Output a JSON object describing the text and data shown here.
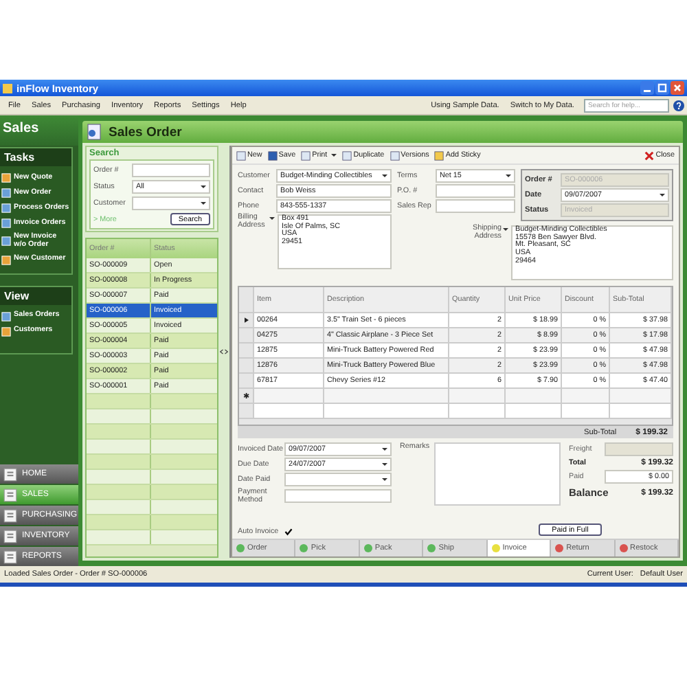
{
  "window": {
    "title": "inFlow Inventory"
  },
  "menu": [
    "File",
    "Sales",
    "Purchasing",
    "Inventory",
    "Reports",
    "Settings",
    "Help"
  ],
  "menu_right": {
    "notice": "Using Sample Data.",
    "switch_link": "Switch to My Data.",
    "help_search": {
      "placeholder": "Search for help..."
    }
  },
  "sidebar": {
    "title": "Sales",
    "tasks": {
      "title": "Tasks",
      "items": [
        "New Quote",
        "New Order",
        "Process Orders",
        "Invoice Orders",
        "New Invoice w/o Order",
        "New Customer"
      ]
    },
    "view": {
      "title": "View",
      "items": [
        "Sales Orders",
        "Customers"
      ]
    },
    "nav": [
      {
        "label": "HOME",
        "selected": false
      },
      {
        "label": "SALES",
        "selected": true
      },
      {
        "label": "PURCHASING",
        "selected": false
      },
      {
        "label": "INVENTORY",
        "selected": false
      },
      {
        "label": "REPORTS",
        "selected": false
      }
    ]
  },
  "page_title": "Sales Order",
  "search": {
    "title": "Search",
    "fields": [
      {
        "label": "Order #",
        "kind": "text"
      },
      {
        "label": "Status",
        "kind": "dropdown",
        "value": "All"
      },
      {
        "label": "Customer",
        "kind": "dropdown"
      }
    ],
    "more": "> More",
    "button": "Search"
  },
  "orders": {
    "columns": [
      "Order #",
      "Status"
    ],
    "rows": [
      {
        "order": "SO-000009",
        "status": "Open",
        "selected": false
      },
      {
        "order": "SO-000008",
        "status": "In Progress",
        "selected": false
      },
      {
        "order": "SO-000007",
        "status": "Paid",
        "selected": false
      },
      {
        "order": "SO-000006",
        "status": "Invoiced",
        "selected": true
      },
      {
        "order": "SO-000005",
        "status": "Invoiced",
        "selected": false
      },
      {
        "order": "SO-000004",
        "status": "Paid",
        "selected": false
      },
      {
        "order": "SO-000003",
        "status": "Paid",
        "selected": false
      },
      {
        "order": "SO-000002",
        "status": "Paid",
        "selected": false
      },
      {
        "order": "SO-000001",
        "status": "Paid",
        "selected": false
      }
    ]
  },
  "toolbar": [
    "New",
    "Save",
    "Print",
    "Duplicate",
    "Versions",
    "Add Sticky"
  ],
  "close": "Close",
  "customer": {
    "customer": {
      "label": "Customer",
      "value": "Budget-Minding Collectibles"
    },
    "contact": {
      "label": "Contact",
      "value": "Bob Weiss"
    },
    "phone": {
      "label": "Phone",
      "value": "843-555-1337"
    },
    "billing": {
      "label": "Billing Address",
      "value": "Box 491\nIsle Of Palms,  SC\nUSA\n29451"
    }
  },
  "terms": {
    "terms": {
      "label": "Terms",
      "value": "Net 15"
    },
    "po": {
      "label": "P.O. #"
    },
    "rep": {
      "label": "Sales Rep"
    }
  },
  "order_info": {
    "order": {
      "label": "Order #",
      "value": "SO-000006"
    },
    "date": {
      "label": "Date",
      "value": "09/07/2007"
    },
    "status": {
      "label": "Status",
      "value": "Invoiced"
    }
  },
  "shipping": {
    "label": "Shipping Address",
    "value": "Budget-Minding Collectibles\n15578 Ben Sawyer Blvd.\nMt. Pleasant,  SC\nUSA\n29464"
  },
  "items": {
    "columns": [
      "Item",
      "Description",
      "Quantity",
      "Unit Price",
      "Discount",
      "Sub-Total"
    ],
    "rows": [
      {
        "item": "00264",
        "description": "3.5\" Train Set - 6 pieces",
        "quantity": "2",
        "unit_price": "$ 18.99",
        "discount": "0 %",
        "subtotal": "$ 37.98",
        "current": true
      },
      {
        "item": "04275",
        "description": "4\" Classic Airplane - 3 Piece Set",
        "quantity": "2",
        "unit_price": "$ 8.99",
        "discount": "0 %",
        "subtotal": "$ 17.98",
        "current": false
      },
      {
        "item": "12875",
        "description": "Mini-Truck Battery Powered Red",
        "quantity": "2",
        "unit_price": "$ 23.99",
        "discount": "0 %",
        "subtotal": "$ 47.98",
        "current": false
      },
      {
        "item": "12876",
        "description": "Mini-Truck Battery Powered Blue",
        "quantity": "2",
        "unit_price": "$ 23.99",
        "discount": "0 %",
        "subtotal": "$ 47.98",
        "current": false
      },
      {
        "item": "67817",
        "description": "Chevy Series #12",
        "quantity": "6",
        "unit_price": "$ 7.90",
        "discount": "0 %",
        "subtotal": "$ 47.40",
        "current": false
      }
    ],
    "new_row_mark": "✱",
    "subtotal_label": "Sub-Total",
    "subtotal": "$ 199.32"
  },
  "payment": {
    "fields": [
      {
        "label": "Invoiced Date",
        "value": "09/07/2007",
        "kind": "dropdown"
      },
      {
        "label": "Due Date",
        "value": "24/07/2007",
        "kind": "dropdown"
      },
      {
        "label": "Date Paid",
        "kind": "dropdown"
      },
      {
        "label": "Payment Method",
        "kind": "text"
      }
    ],
    "auto_invoice": {
      "label": "Auto Invoice",
      "checked": true
    },
    "remarks_label": "Remarks"
  },
  "totals": {
    "freight_label": "Freight",
    "total_label": "Total",
    "total": "$ 199.32",
    "paid_label": "Paid",
    "paid": "$ 0.00",
    "balance_label": "Balance",
    "balance": "$ 199.32",
    "paid_in_full": "Paid in Full"
  },
  "stages": [
    {
      "label": "Order",
      "color": "#5cb85c",
      "selected": false
    },
    {
      "label": "Pick",
      "color": "#5cb85c",
      "selected": false
    },
    {
      "label": "Pack",
      "color": "#5cb85c",
      "selected": false
    },
    {
      "label": "Ship",
      "color": "#5cb85c",
      "selected": false
    },
    {
      "label": "Invoice",
      "color": "#e8e040",
      "selected": true
    },
    {
      "label": "Return",
      "color": "#d9534f",
      "selected": false
    },
    {
      "label": "Restock",
      "color": "#d9534f",
      "selected": false
    }
  ],
  "status_bar": {
    "message": "Loaded Sales Order - Order # SO-000006",
    "user_label": "Current User:",
    "user": "Default User"
  }
}
